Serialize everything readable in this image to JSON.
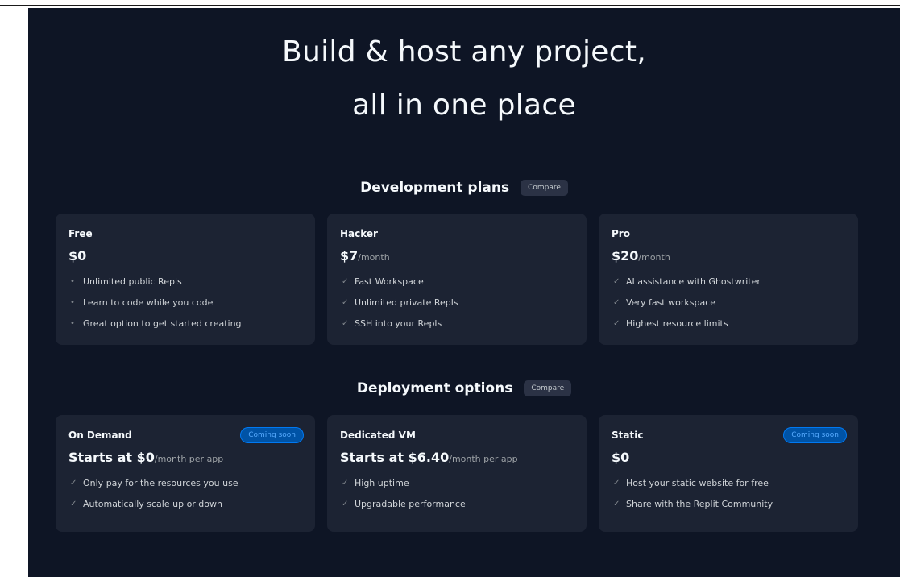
{
  "hero": {
    "line1": "Build & host any project,",
    "line2": "all in one place"
  },
  "development": {
    "title": "Development plans",
    "compare_label": "Compare",
    "plans": [
      {
        "name": "Free",
        "price": "$0",
        "unit": "",
        "features": [
          "Unlimited public Repls",
          "Learn to code while you code",
          "Great option to get started creating"
        ],
        "marker": "bullet"
      },
      {
        "name": "Hacker",
        "price": "$7",
        "unit": "/month",
        "features": [
          "Fast Workspace",
          "Unlimited private Repls",
          "SSH into your Repls"
        ],
        "marker": "check"
      },
      {
        "name": "Pro",
        "price": "$20",
        "unit": "/month",
        "features": [
          "AI assistance with Ghostwriter",
          "Very fast workspace",
          "Highest resource limits"
        ],
        "marker": "check"
      }
    ]
  },
  "deployment": {
    "title": "Deployment options",
    "compare_label": "Compare",
    "options": [
      {
        "name": "On Demand",
        "badge": "Coming soon",
        "price": "Starts at $0",
        "unit": "/month per app",
        "features": [
          "Only pay for the resources you use",
          "Automatically scale up or down"
        ]
      },
      {
        "name": "Dedicated VM",
        "badge": "",
        "price": "Starts at $6.40",
        "unit": "/month per app",
        "features": [
          "High uptime",
          "Upgradable performance"
        ]
      },
      {
        "name": "Static",
        "badge": "Coming soon",
        "price": "$0",
        "unit": "",
        "features": [
          "Host your static website for free",
          "Share with the Replit Community"
        ]
      }
    ]
  },
  "icons": {
    "bullet": "•",
    "check": "✓"
  },
  "colors": {
    "background": "#0e1525",
    "card": "#1c2333",
    "badge": "#0053a6",
    "badge_text": "#57abff"
  }
}
